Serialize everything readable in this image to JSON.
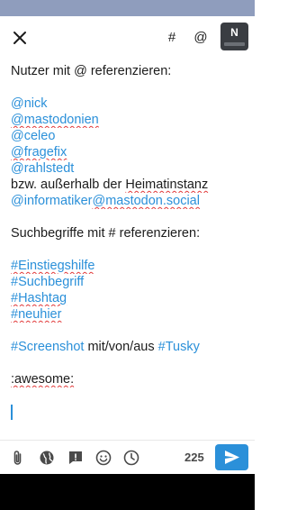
{
  "colors": {
    "accent": "#2b90d9",
    "status_bar": "#8f9dbd",
    "spellcheck": "#e23b3b",
    "text": "#1c1c1c"
  },
  "toolbar": {
    "close_icon": "close-icon",
    "hashtag_label": "#",
    "mention_label": "@",
    "avatar_text": "N"
  },
  "compose": {
    "heading_mentions": "Nutzer mit @ referenzieren:",
    "mentions": [
      "@nick",
      "@mastodonien",
      "@celeo",
      "@fragefix",
      "@rahlstedt"
    ],
    "remote_prefix": "bzw. außerhalb der ",
    "remote_word": "Heimatinstanz",
    "remote_account_user": "@informatiker",
    "remote_account_domain": "@mastodon.social",
    "heading_hashtags": "Suchbegriffe mit # referenzieren:",
    "hashtags": [
      "#Einstiegshilfe",
      "#Suchbegriff",
      "#Hashtag",
      "#neuhier"
    ],
    "screenshot_tag": "#Screenshot",
    "screenshot_middle": " mit/von/aus ",
    "tusky_tag": "#Tusky",
    "emoji_code": ":awesome:"
  },
  "bottom_bar": {
    "icons": [
      "attach-icon",
      "globe-icon",
      "content-warning-icon",
      "emoji-icon",
      "schedule-icon"
    ],
    "char_count": "225",
    "send_icon": "send-icon"
  }
}
